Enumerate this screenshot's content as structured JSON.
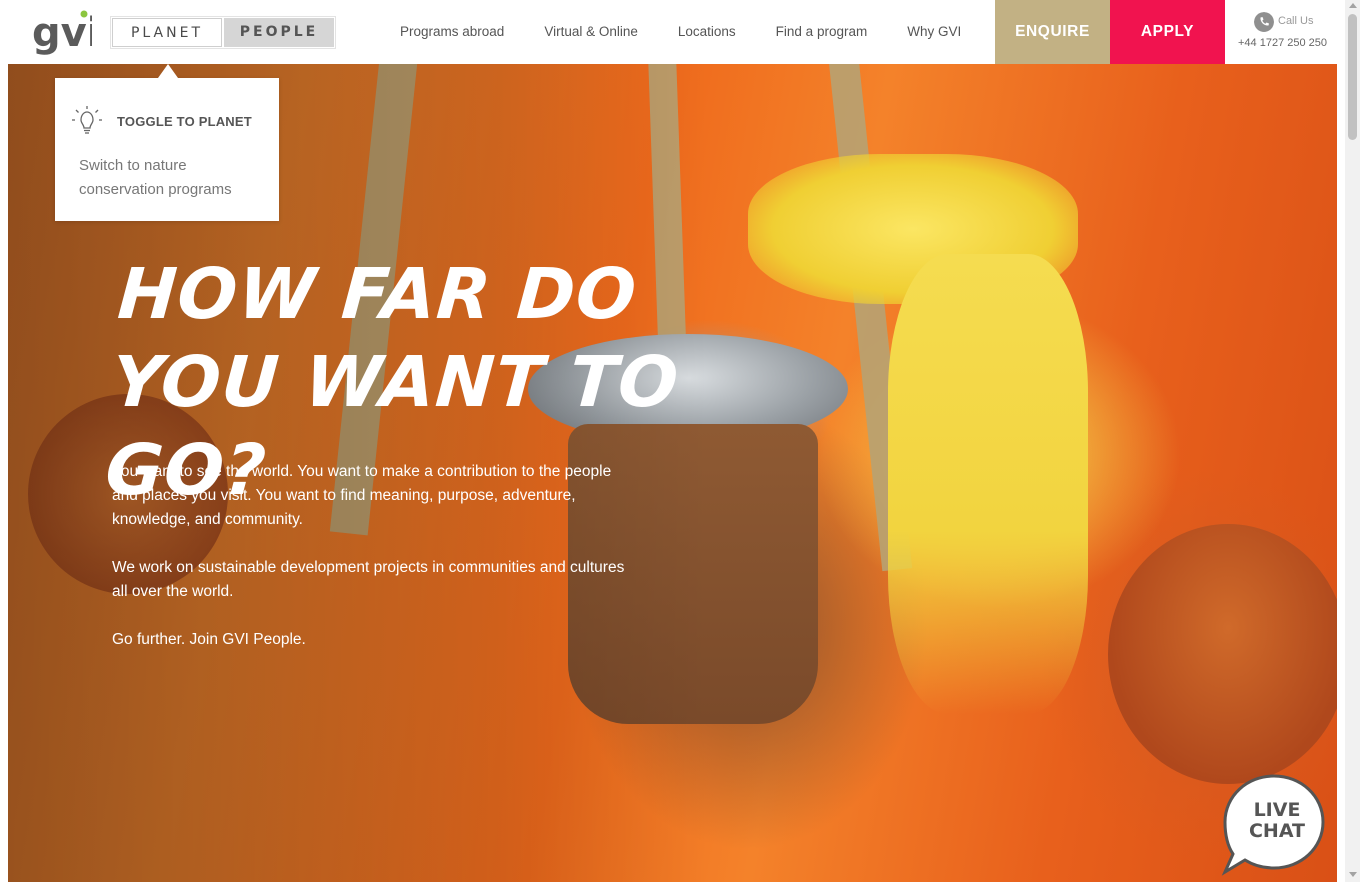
{
  "brand": {
    "logo_text": "gvi",
    "logo_color": "#5b5b5b",
    "accent_green": "#8cc63f"
  },
  "toggle": {
    "planet_label": "PLANET",
    "people_label": "PEOPLE",
    "active": "PEOPLE"
  },
  "nav": {
    "items": [
      {
        "label": "Programs abroad"
      },
      {
        "label": "Virtual & Online"
      },
      {
        "label": "Locations"
      },
      {
        "label": "Find a program"
      },
      {
        "label": "Why GVI"
      }
    ]
  },
  "cta": {
    "enquire_label": "ENQUIRE",
    "enquire_color": "#c2b184",
    "apply_label": "APPLY",
    "apply_color": "#f1134f"
  },
  "contact": {
    "label": "Call Us",
    "phone": "+44 1727 250 250",
    "icon": "phone-icon"
  },
  "tooltip": {
    "icon": "lightbulb-icon",
    "title": "TOGGLE TO PLANET",
    "text": "Switch to nature conservation programs"
  },
  "hero": {
    "headline_line1": "HOW FAR DO",
    "headline_line2": "YOU WANT TO GO?",
    "paragraph1": "You want to see the world. You want to make a contribution to the people and places you visit. You want to find meaning, purpose, adventure, knowledge, and community.",
    "paragraph2": "We work on sustainable development projects in communities and cultures all over the world.",
    "paragraph3": "Go further. Join GVI People."
  },
  "livechat": {
    "line1": "LIVE",
    "line2": "CHAT",
    "icon": "speech-bubble-icon"
  }
}
